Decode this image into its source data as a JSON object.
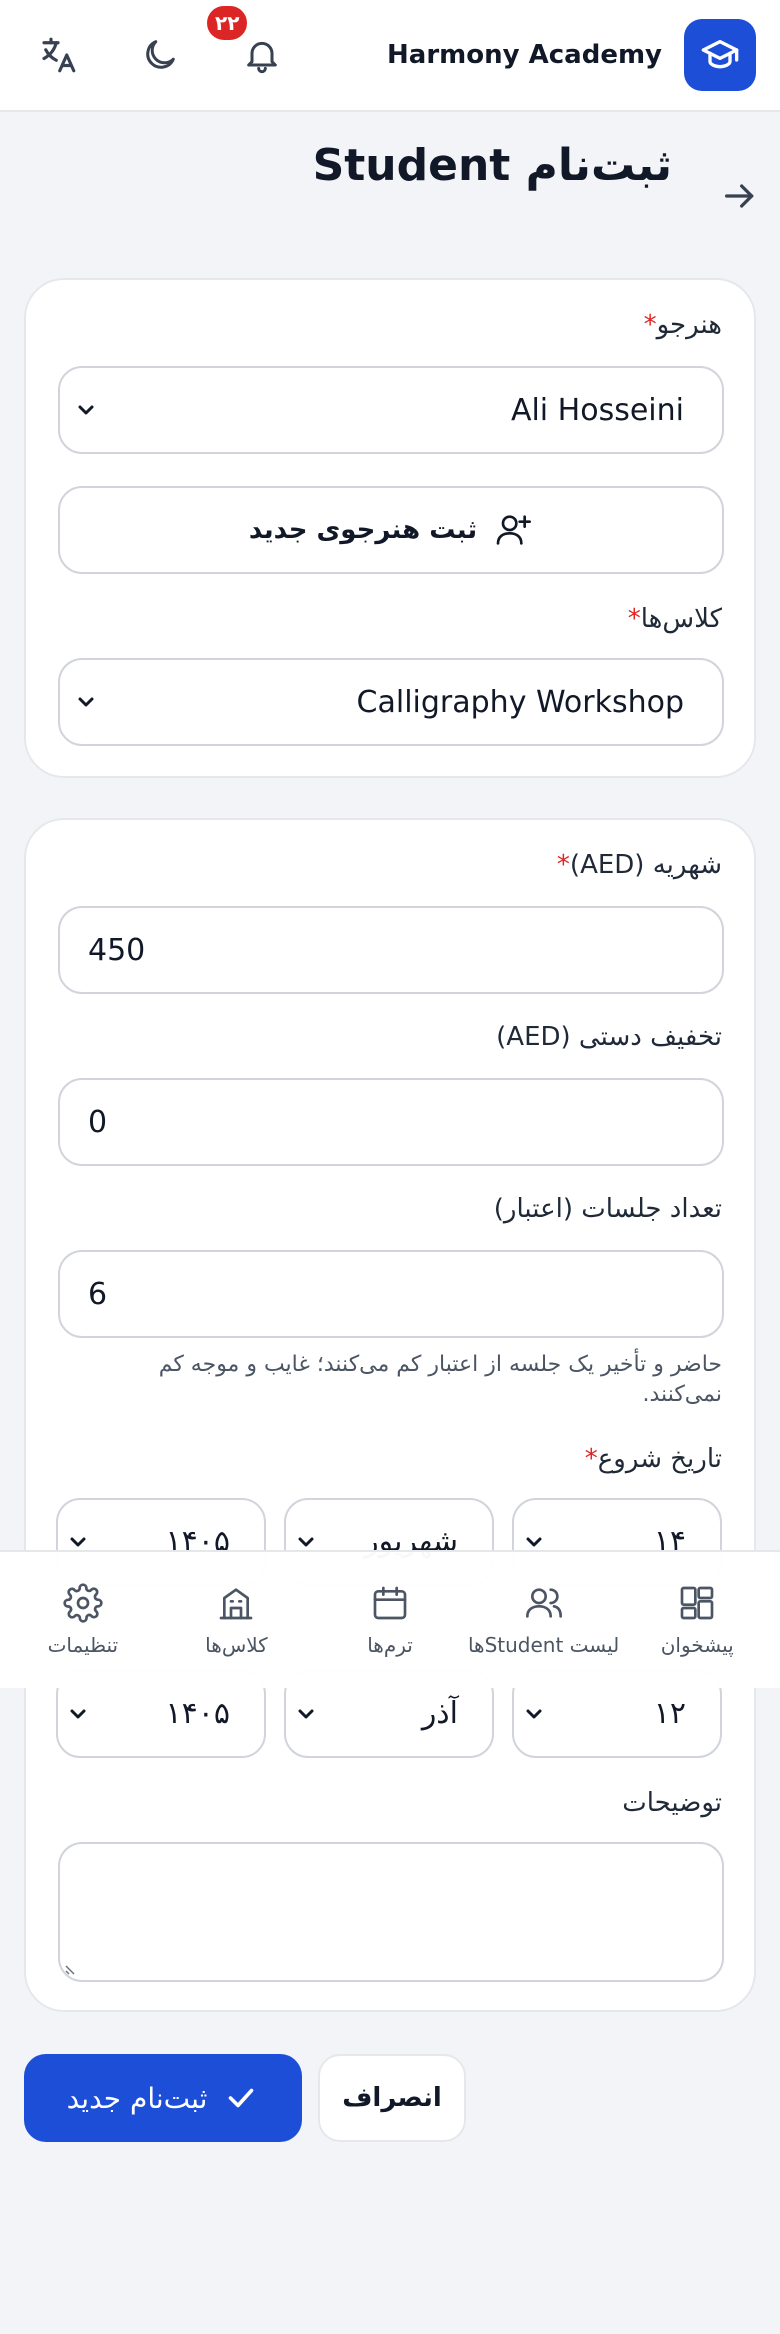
{
  "header": {
    "brand_name": "Harmony Academy",
    "notification_count": "۲۲"
  },
  "page": {
    "title": "ثبت‌نام Student"
  },
  "form": {
    "student": {
      "label": "هنرجو",
      "required": "*",
      "value": "Ali Hosseini"
    },
    "add_student_button": "ثبت هنرجوی جدید",
    "classes": {
      "label": "کلاس‌ها",
      "required": "*",
      "value": "Calligraphy Workshop"
    },
    "tuition": {
      "label": "شهریه (AED)",
      "required": "*",
      "value": "450"
    },
    "discount": {
      "label": "تخفیف دستی (AED)",
      "value": "0"
    },
    "sessions": {
      "label": "تعداد جلسات (اعتبار)",
      "value": "6",
      "hint": "حاضر و تأخیر یک جلسه از اعتبار کم می‌کنند؛ غایب و موجه کم نمی‌کنند."
    },
    "start_date": {
      "label": "تاریخ شروع",
      "required": "*",
      "day": "۱۴",
      "month": "شهریور",
      "year": "۱۴۰۵"
    },
    "end_date": {
      "day": "۱۲",
      "month": "آذر",
      "year": "۱۴۰۵"
    },
    "notes": {
      "label": "توضیحات",
      "value": ""
    }
  },
  "actions": {
    "submit_label": "ثبت‌نام جدید",
    "cancel_label": "انصراف"
  },
  "bottom_nav": {
    "items": [
      {
        "label": "پیشخوان",
        "icon": "dashboard-icon"
      },
      {
        "label": "لیست Studentها",
        "icon": "users-icon"
      },
      {
        "label": "ترم‌ها",
        "icon": "calendar-icon"
      },
      {
        "label": "کلاس‌ها",
        "icon": "building-icon"
      },
      {
        "label": "تنظیمات",
        "icon": "gear-icon"
      }
    ]
  },
  "colors": {
    "primary": "#1d4ed8",
    "danger": "#dc2626",
    "background": "#f3f4f8"
  }
}
